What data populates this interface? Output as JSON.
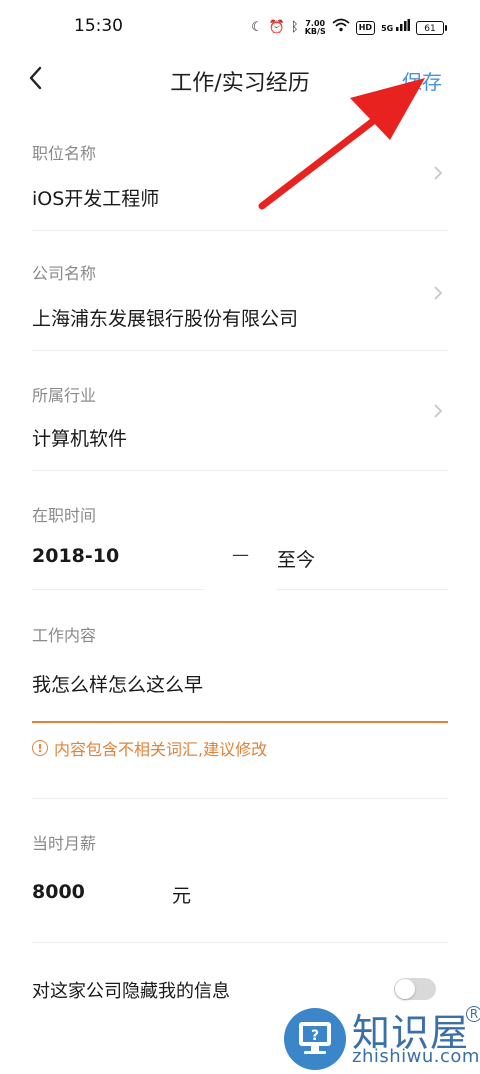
{
  "status_bar": {
    "time": "15:30",
    "net_speed_value": "7.00",
    "net_speed_unit": "KB/S",
    "hd_badge": "HD",
    "signal_label": "5G",
    "battery": "61"
  },
  "header": {
    "title": "工作/实习经历",
    "save_label": "保存"
  },
  "fields": {
    "position": {
      "label": "职位名称",
      "value": "iOS开发工程师"
    },
    "company": {
      "label": "公司名称",
      "value": "上海浦东发展银行股份有限公司"
    },
    "industry": {
      "label": "所属行业",
      "value": "计算机软件"
    },
    "employment": {
      "label": "在职时间",
      "start": "2018-10",
      "separator": "—",
      "end": "至今"
    },
    "content": {
      "label": "工作内容",
      "value": "我怎么样怎么这么早",
      "warning": "内容包含不相关词汇,建议修改"
    },
    "salary": {
      "label": "当时月薪",
      "value": "8000",
      "unit": "元"
    },
    "hide_info": {
      "label": "对这家公司隐藏我的信息",
      "enabled": false
    }
  },
  "colors": {
    "accent": "#4a90e2",
    "warning": "#e0833c",
    "annotation_arrow": "#e8231f"
  },
  "watermark": {
    "brand": "知识屋",
    "domain": "zhishiwu.com"
  }
}
